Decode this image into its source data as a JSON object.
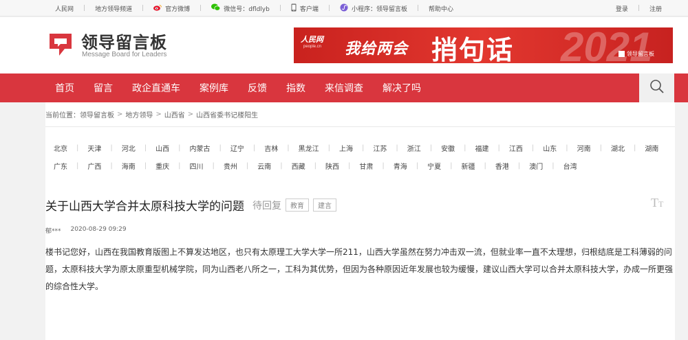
{
  "topbar": {
    "links": [
      {
        "label": "人民网",
        "icon": ""
      },
      {
        "label": "地方领导频道",
        "icon": ""
      },
      {
        "label": "官方微博",
        "icon": "weibo-icon"
      },
      {
        "label": "微信号：dfldlyb",
        "icon": "wechat-icon"
      },
      {
        "label": "客户端",
        "icon": "phone-icon"
      },
      {
        "label": "小程序：领导留言板",
        "icon": "miniprogram-icon"
      },
      {
        "label": "帮助中心",
        "icon": ""
      }
    ],
    "login": "登录",
    "register": "注册"
  },
  "header": {
    "logo_cn": "领导留言板",
    "logo_en": "Message Board for Leaders",
    "banner": {
      "brand": "人民网",
      "brand_sub": "people.cn",
      "slogan1": "我给两会",
      "slogan2": "捎句话",
      "year": "2021",
      "logo_text": "领导留言板"
    }
  },
  "nav": {
    "items": [
      "首页",
      "留言",
      "政企直通车",
      "案例库",
      "反馈",
      "指数",
      "来信调查",
      "解决了吗"
    ]
  },
  "breadcrumb": {
    "label": "当前位置：",
    "items": [
      "领导留言板",
      "地方领导",
      "山西省",
      "山西省委书记楼阳生"
    ]
  },
  "regions": {
    "row1": [
      "北京",
      "天津",
      "河北",
      "山西",
      "内蒙古",
      "辽宁",
      "吉林",
      "黑龙江",
      "上海",
      "江苏",
      "浙江",
      "安徽",
      "福建",
      "江西",
      "山东",
      "河南",
      "湖北",
      "湖南"
    ],
    "row2": [
      "广东",
      "广西",
      "海南",
      "重庆",
      "四川",
      "贵州",
      "云南",
      "西藏",
      "陕西",
      "甘肃",
      "青海",
      "宁夏",
      "新疆",
      "香港",
      "澳门",
      "台湾"
    ]
  },
  "message": {
    "title": "关于山西大学合并太原科技大学的问题",
    "status": "待回复",
    "tags": [
      "教育",
      "建言"
    ],
    "author": "郁***",
    "date": "2020-08-29 09:29",
    "body": "楼书记您好，山西在我国教育版图上不算发达地区，也只有太原理工大学大学一所211，山西大学虽然在努力冲击双一流，但就业率一直不太理想，归根结底是工科薄弱的问题，太原科技大学为原太原重型机械学院，同为山西老八所之一，工科为其优势，但因为各种原因近年发展也较为缓慢，建议山西大学可以合并太原科技大学，办成一所更强的综合性大学。"
  },
  "colors": {
    "accent": "#d9363e",
    "banner": "#d9322c"
  }
}
